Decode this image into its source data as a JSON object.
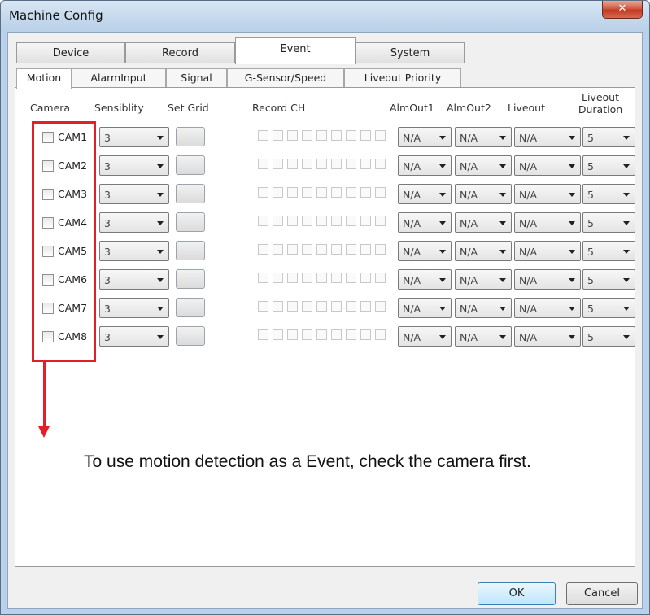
{
  "window": {
    "title": "Machine Config",
    "close_icon": "close-icon"
  },
  "tabs": [
    {
      "label": "Device",
      "active": false
    },
    {
      "label": "Record",
      "active": false
    },
    {
      "label": "Event",
      "active": true
    },
    {
      "label": "System",
      "active": false
    }
  ],
  "subtabs": [
    {
      "label": "Motion",
      "active": true
    },
    {
      "label": "AlarmInput",
      "active": false
    },
    {
      "label": "Signal",
      "active": false
    },
    {
      "label": "G-Sensor/Speed",
      "active": false
    },
    {
      "label": "Liveout Priority",
      "active": false
    }
  ],
  "columns": {
    "camera": "Camera",
    "sensibility": "Sensiblity",
    "set_grid": "Set Grid",
    "record_ch": "Record CH",
    "almout1": "AlmOut1",
    "almout2": "AlmOut2",
    "liveout": "Liveout",
    "liveout_duration_1": "Liveout",
    "liveout_duration_2": "Duration"
  },
  "rows": [
    {
      "camera": "CAM1",
      "checked": false,
      "sensibility": "3",
      "almout1": "N/A",
      "almout2": "N/A",
      "liveout": "N/A",
      "duration": "5"
    },
    {
      "camera": "CAM2",
      "checked": false,
      "sensibility": "3",
      "almout1": "N/A",
      "almout2": "N/A",
      "liveout": "N/A",
      "duration": "5"
    },
    {
      "camera": "CAM3",
      "checked": false,
      "sensibility": "3",
      "almout1": "N/A",
      "almout2": "N/A",
      "liveout": "N/A",
      "duration": "5"
    },
    {
      "camera": "CAM4",
      "checked": false,
      "sensibility": "3",
      "almout1": "N/A",
      "almout2": "N/A",
      "liveout": "N/A",
      "duration": "5"
    },
    {
      "camera": "CAM5",
      "checked": false,
      "sensibility": "3",
      "almout1": "N/A",
      "almout2": "N/A",
      "liveout": "N/A",
      "duration": "5"
    },
    {
      "camera": "CAM6",
      "checked": false,
      "sensibility": "3",
      "almout1": "N/A",
      "almout2": "N/A",
      "liveout": "N/A",
      "duration": "5"
    },
    {
      "camera": "CAM7",
      "checked": false,
      "sensibility": "3",
      "almout1": "N/A",
      "almout2": "N/A",
      "liveout": "N/A",
      "duration": "5"
    },
    {
      "camera": "CAM8",
      "checked": false,
      "sensibility": "3",
      "almout1": "N/A",
      "almout2": "N/A",
      "liveout": "N/A",
      "duration": "5"
    }
  ],
  "annotation": {
    "text": "To use motion detection as a Event, check the camera first.",
    "color": "#e41e26"
  },
  "buttons": {
    "ok": "OK",
    "cancel": "Cancel"
  }
}
